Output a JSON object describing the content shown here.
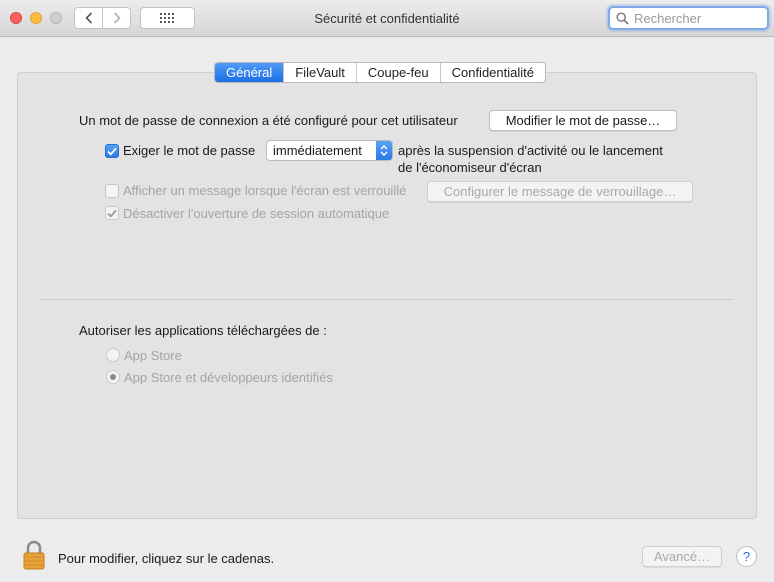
{
  "window": {
    "title": "Sécurité et confidentialité",
    "search_placeholder": "Rechercher"
  },
  "tabs": [
    {
      "label": "Général",
      "active": true
    },
    {
      "label": "FileVault",
      "active": false
    },
    {
      "label": "Coupe-feu",
      "active": false
    },
    {
      "label": "Confidentialité",
      "active": false
    }
  ],
  "general": {
    "password_set_text": "Un mot de passe de connexion a été configuré pour cet utilisateur",
    "change_password_button": "Modifier le mot de passe…",
    "require_password": {
      "label": "Exiger le mot de passe",
      "checked": true
    },
    "require_password_delay": "immédiatement",
    "after_text_line1": "après la suspension d'activité ou le lancement",
    "after_text_line2": "de l'économiseur d'écran",
    "show_message": {
      "label": "Afficher un message lorsque l'écran est verrouillé",
      "checked": false,
      "enabled": false
    },
    "set_lock_message_button": "Configurer le message de verrouillage…",
    "disable_auto_login": {
      "label": "Désactiver l'ouverture de session automatique",
      "checked": true,
      "enabled": false
    }
  },
  "downloads": {
    "heading": "Autoriser les applications téléchargées de :",
    "options": [
      {
        "label": "App Store",
        "selected": false
      },
      {
        "label": "App Store et développeurs identifiés",
        "selected": true
      }
    ]
  },
  "footer": {
    "lock_text": "Pour modifier, cliquez sur le cadenas.",
    "advanced_button": "Avancé…",
    "help_button": "?"
  },
  "colors": {
    "accent": "#2a7ae8",
    "lock": "#e8a23a"
  }
}
